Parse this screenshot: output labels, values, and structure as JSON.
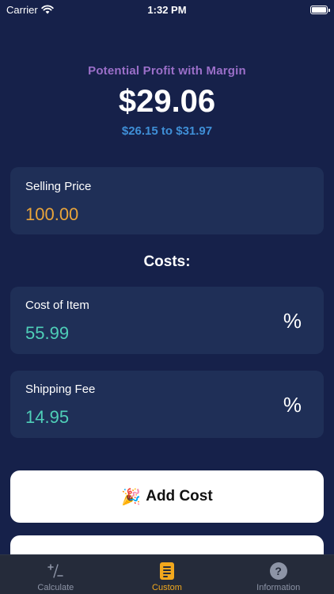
{
  "status_bar": {
    "carrier": "Carrier",
    "time": "1:32 PM",
    "icons": [
      "wifi-icon",
      "battery-icon"
    ]
  },
  "header": {
    "label": "Potential Profit with Margin",
    "profit": "$29.06",
    "range": "$26.15 to $31.97"
  },
  "selling_price": {
    "label": "Selling Price",
    "value": "100.00"
  },
  "costs": {
    "title": "Costs:",
    "items": [
      {
        "label": "Cost of Item",
        "value": "55.99",
        "unit": "%"
      },
      {
        "label": "Shipping Fee",
        "value": "14.95",
        "unit": "%"
      }
    ]
  },
  "add_cost": {
    "icon": "🎉",
    "label": "Add Cost"
  },
  "tab_bar": {
    "tabs": [
      {
        "label": "Calculate",
        "icon": "calculator-icon",
        "active": false
      },
      {
        "label": "Custom",
        "icon": "document-icon",
        "active": true
      },
      {
        "label": "Information",
        "icon": "question-icon",
        "active": false
      }
    ]
  },
  "colors": {
    "background": "#16214a",
    "card": "#1f2f57",
    "header_label": "#9b6fc9",
    "range": "#3f8fd7",
    "selling_value": "#e9a43a",
    "cost_value": "#4fcfb8",
    "tab_active": "#f2a81d",
    "tab_inactive": "#8d94a6"
  }
}
